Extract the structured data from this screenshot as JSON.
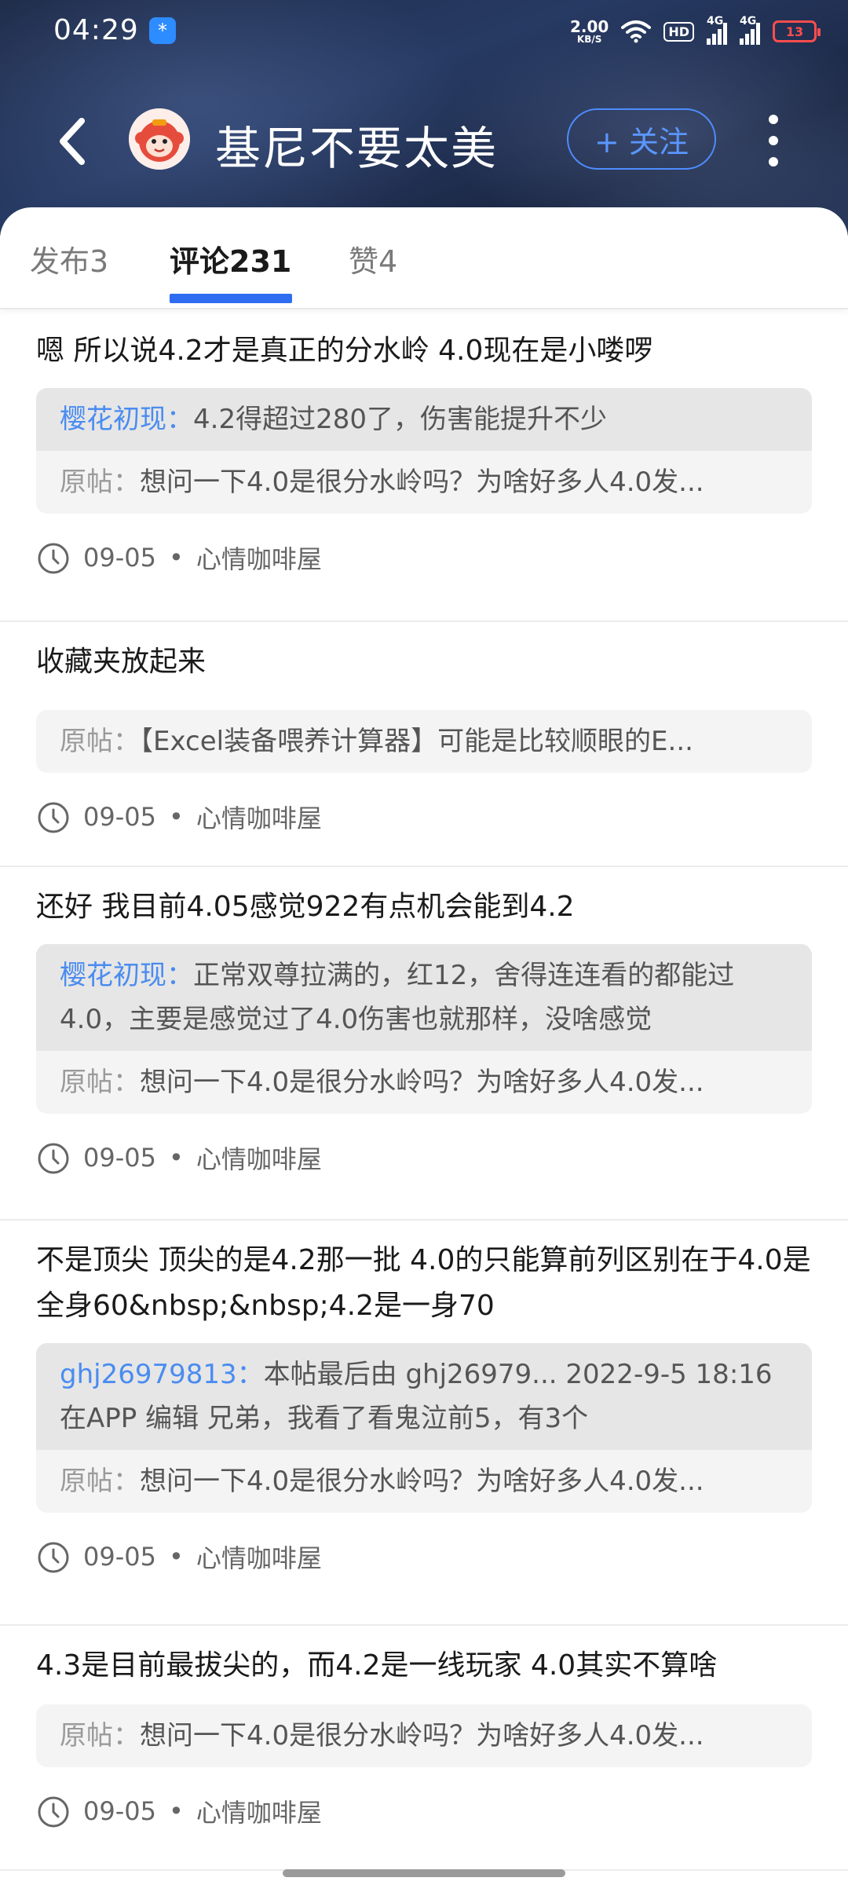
{
  "status": {
    "time": "04:29",
    "net_value": "2.00",
    "net_unit": "KB/S",
    "hd": "HD",
    "sig1": "4G",
    "sig2": "4G",
    "battery": "13"
  },
  "header": {
    "name": "基尼不要太美",
    "follow_label": "+ 关注"
  },
  "tabs": [
    {
      "label": "发布3"
    },
    {
      "label": "评论231"
    },
    {
      "label": "赞4"
    }
  ],
  "orig_prefix": "原帖：",
  "items": [
    {
      "text": "嗯 所以说4.2才是真正的分水岭 4.0现在是小喽啰",
      "reply_user": "樱花初现：",
      "reply_text": "4.2得超过280了，伤害能提升不少",
      "orig": "想问一下4.0是很分水岭吗？为啥好多人4.0发...",
      "date": "09-05",
      "board": "心情咖啡屋"
    },
    {
      "text": "收藏夹放起来",
      "orig": "【Excel装备喂养计算器】可能是比较顺眼的E...",
      "date": "09-05",
      "board": "心情咖啡屋"
    },
    {
      "text": "还好 我目前4.05感觉922有点机会能到4.2",
      "reply_user": "樱花初现：",
      "reply_text": "正常双尊拉满的，红12，舍得连连看的都能过4.0，主要是感觉过了4.0伤害也就那样，没啥感觉",
      "orig": "想问一下4.0是很分水岭吗？为啥好多人4.0发...",
      "date": "09-05",
      "board": "心情咖啡屋"
    },
    {
      "text": "不是顶尖 顶尖的是4.2那一批 4.0的只能算前列区别在于4.0是全身60&nbsp;&nbsp;4.2是一身70",
      "reply_user": "ghj26979813：",
      "reply_text": "本帖最后由 ghj26979... 2022-9-5 18:16 在APP 编辑 兄弟，我看了看鬼泣前5，有3个",
      "orig": "想问一下4.0是很分水岭吗？为啥好多人4.0发...",
      "date": "09-05",
      "board": "心情咖啡屋"
    },
    {
      "text": "4.3是目前最拔尖的，而4.2是一线玩家 4.0其实不算啥",
      "orig": "想问一下4.0是很分水岭吗？为啥好多人4.0发...",
      "date": "09-05",
      "board": "心情咖啡屋"
    }
  ]
}
